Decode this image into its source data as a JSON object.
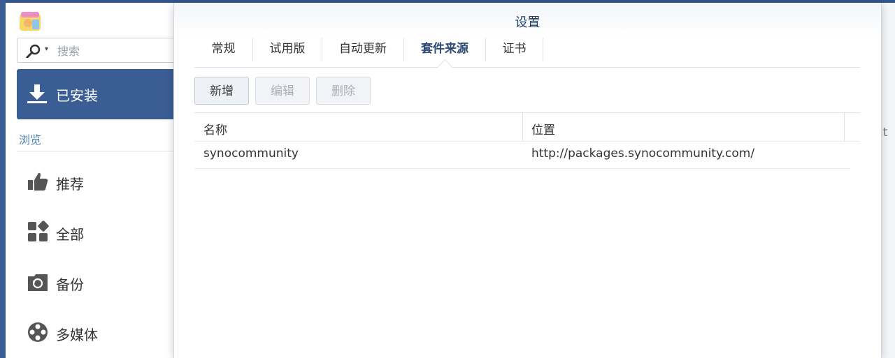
{
  "sidebar": {
    "search": {
      "placeholder": "搜索"
    },
    "installed_label": "已安装",
    "browse_label": "浏览",
    "nav": [
      {
        "label": "推荐",
        "icon": "thumbs-up-icon"
      },
      {
        "label": "全部",
        "icon": "grid-shapes-icon"
      },
      {
        "label": "备份",
        "icon": "backup-icon"
      },
      {
        "label": "多媒体",
        "icon": "film-reel-icon"
      }
    ]
  },
  "background_text": "it",
  "dialog": {
    "title": "设置",
    "tabs": [
      "常规",
      "试用版",
      "自动更新",
      "套件来源",
      "证书"
    ],
    "active_tab": "套件来源",
    "buttons": {
      "add": "新增",
      "edit": "编辑",
      "delete": "删除"
    },
    "grid": {
      "columns": [
        "名称",
        "位置"
      ],
      "rows": [
        {
          "name": "synocommunity",
          "location": "http://packages.synocommunity.com/"
        }
      ]
    }
  },
  "colors": {
    "accent": "#3a5d94",
    "title": "#1e3d66",
    "browse": "#4f7fb0"
  }
}
